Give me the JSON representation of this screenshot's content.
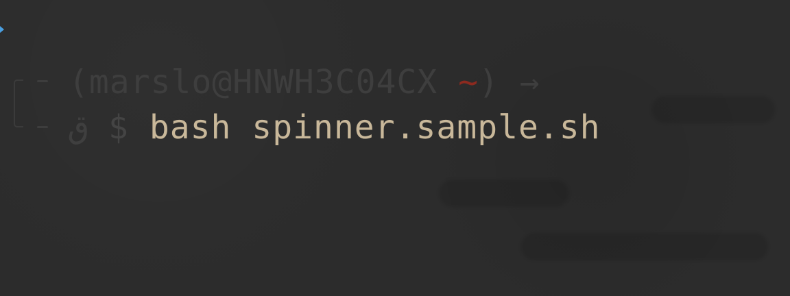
{
  "terminal": {
    "prompt": {
      "open_paren": "(",
      "user_host": "marslo@HNWH3C04CX",
      "space": " ",
      "cwd": "~",
      "close_paren": ")",
      "arrow": " →"
    },
    "line2": {
      "glyph": "ق",
      "dollar": "$",
      "command": "bash spinner.sample.sh"
    }
  },
  "colors": {
    "background": "#2c2c2c",
    "prompt_dim": "#3e3e3e",
    "tilde": "#8c2a1f",
    "command": "#c9b89a",
    "cursor_marker": "#4a9fe0"
  }
}
